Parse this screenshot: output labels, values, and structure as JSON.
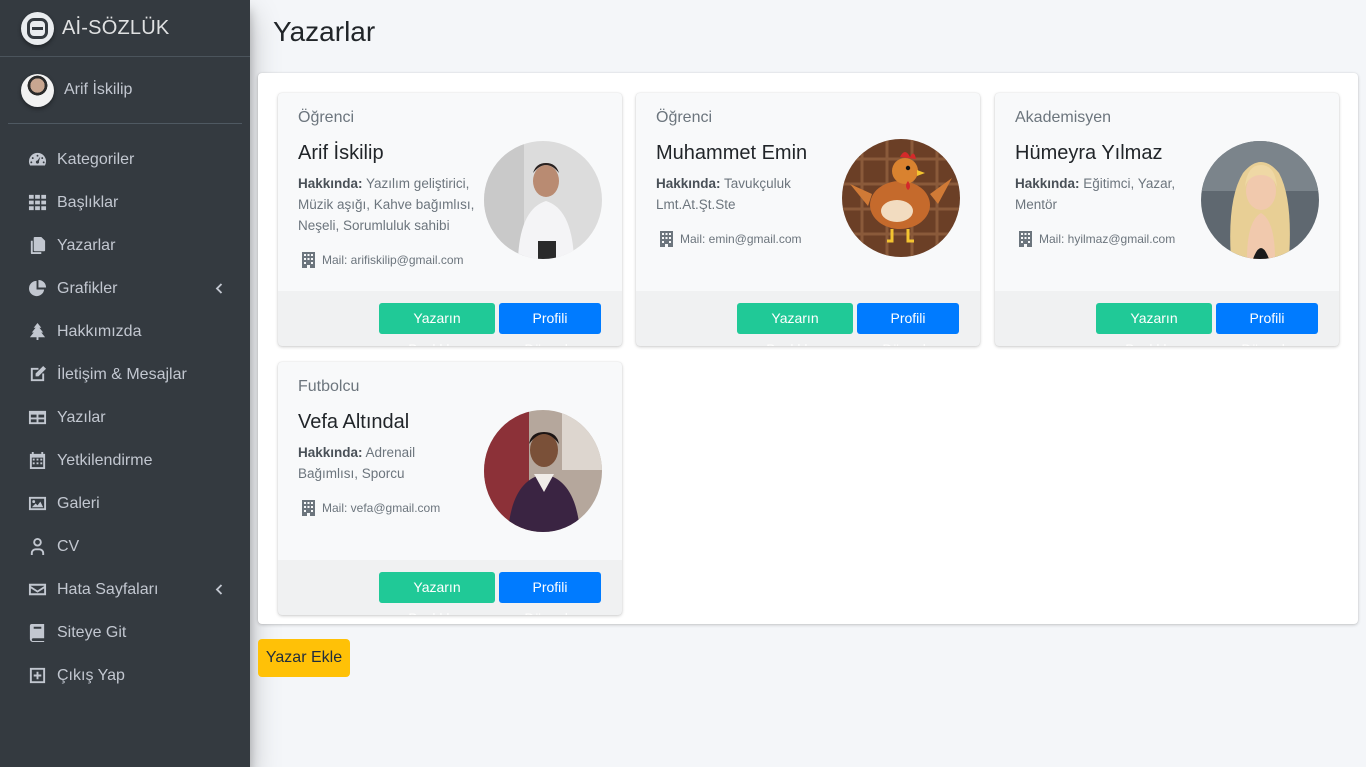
{
  "brand": {
    "name": "Aİ-SÖZLÜK"
  },
  "user": {
    "name": "Arif İskilip"
  },
  "nav": [
    {
      "label": "Kategoriler",
      "icon": "dashboard-icon"
    },
    {
      "label": "Başlıklar",
      "icon": "grid-icon"
    },
    {
      "label": "Yazarlar",
      "icon": "copy-icon"
    },
    {
      "label": "Grafikler",
      "icon": "pie-chart-icon",
      "caret": true
    },
    {
      "label": "Hakkımızda",
      "icon": "tree-icon"
    },
    {
      "label": "İletişim & Mesajlar",
      "icon": "edit-icon"
    },
    {
      "label": "Yazılar",
      "icon": "table-icon"
    },
    {
      "label": "Yetkilendirme",
      "icon": "calendar-icon"
    },
    {
      "label": "Galeri",
      "icon": "image-icon"
    },
    {
      "label": "CV",
      "icon": "user-icon"
    },
    {
      "label": "Hata Sayfaları",
      "icon": "envelope-icon",
      "caret": true
    },
    {
      "label": "Siteye Git",
      "icon": "book-icon"
    },
    {
      "label": "Çıkış Yap",
      "icon": "plus-square-icon"
    }
  ],
  "page": {
    "title": "Yazarlar",
    "add_button": "Yazar Ekle"
  },
  "labels": {
    "about": "Hakkında:",
    "mail_prefix": "Mail: ",
    "titles_button": "Yazarın Başlıkları",
    "edit_button": "Profili Düzenle"
  },
  "writers": [
    {
      "role": "Öğrenci",
      "name": "Arif İskilip",
      "about": "Yazılım geliştirici, Müzik aşığı, Kahve bağımlısı, Neşeli, Sorumluluk sahibi",
      "mail": "Mail: arifiskilip@gmail.com"
    },
    {
      "role": "Öğrenci",
      "name": "Muhammet Emin",
      "about": "Tavukçuluk Lmt.At.Şt.Ste",
      "mail": "Mail: emin@gmail.com"
    },
    {
      "role": "Akademisyen",
      "name": "Hümeyra Yılmaz",
      "about": "Eğitimci, Yazar, Mentör",
      "mail": "Mail: hyilmaz@gmail.com"
    },
    {
      "role": "Futbolcu",
      "name": "Vefa Altındal",
      "about": "Adrenail Bağımlısı, Sporcu",
      "mail": "Mail: vefa@gmail.com"
    }
  ],
  "colors": {
    "sidebar": "#343a40",
    "teal": "#20c997",
    "blue": "#007bff",
    "warning": "#ffc107"
  }
}
